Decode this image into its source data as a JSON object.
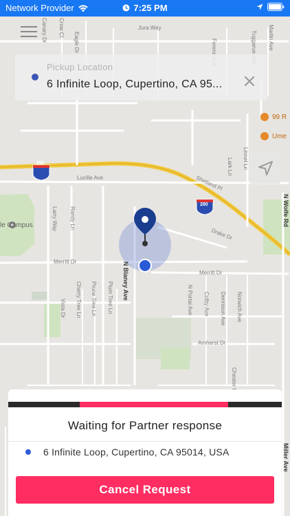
{
  "status_bar": {
    "carrier": "Network Provider",
    "time": "7:25 PM",
    "color": "#1877f2"
  },
  "menu": {
    "icon": "hamburger-menu-icon"
  },
  "pickup": {
    "label": "Pickup Location",
    "value": "6 Infinite Loop, Cupertino, CA 95...",
    "dot_color": "#3b56b5",
    "clear_icon": "close-icon"
  },
  "locate": {
    "icon": "location-arrow-icon"
  },
  "map": {
    "highway_shield": "280",
    "streets": [
      "Jura Way",
      "Crow Ct",
      "Eagle Dr",
      "Canary Dr",
      "Martin Ave",
      "Lucille Ave",
      "Shetland Pl",
      "Larry Way",
      "Randy Ln",
      "Merritt Dr",
      "Drake Dr",
      "N Blaney Ave",
      "Cherry Tree Ln",
      "Prune Tree Ln",
      "Plum Tree Ln",
      "Vista Dr",
      "N Portal Ave",
      "Colby Ave",
      "Dennison Ave",
      "Norwich Ave",
      "Amherst Dr",
      "N Wolfe Rd",
      "Linnet Ln",
      "Lark Ln",
      "Miller Ave",
      "Chester Rd",
      "Tuggarue Ave",
      "Ferenc Ave"
    ],
    "places": [
      "le Campus",
      "99 R",
      "Ume"
    ]
  },
  "panel": {
    "status": "Waiting for Partner response",
    "address": "6 Infinite Loop, Cupertino, CA 95014, USA",
    "cancel_label": "Cancel Request",
    "accent_color": "#ff2d62",
    "progress_fraction": 0.54
  }
}
